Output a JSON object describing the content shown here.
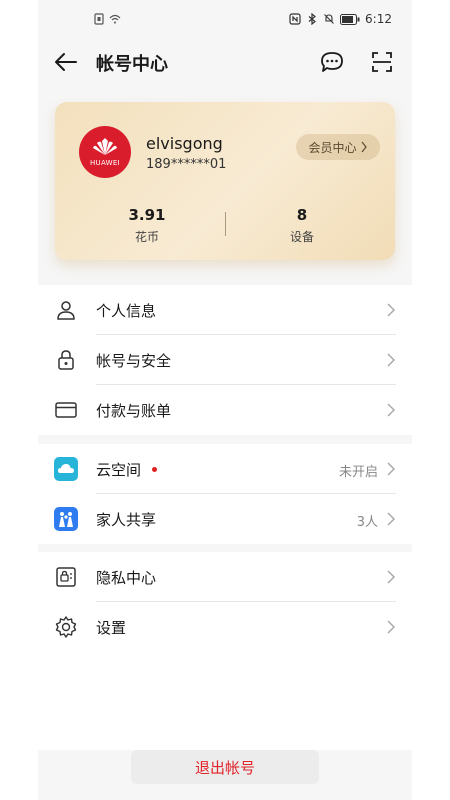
{
  "status_bar": {
    "time": "6:12"
  },
  "header": {
    "title": "帐号中心"
  },
  "account_card": {
    "username": "elvisgong",
    "phone": "189******01",
    "logo_text": "HUAWEI",
    "member_center_label": "会员中心",
    "stats": [
      {
        "value": "3.91",
        "label": "花币"
      },
      {
        "value": "8",
        "label": "设备"
      }
    ]
  },
  "menu_primary": [
    {
      "label": "个人信息",
      "icon": "person-icon"
    },
    {
      "label": "帐号与安全",
      "icon": "lock-icon"
    },
    {
      "label": "付款与账单",
      "icon": "card-icon"
    }
  ],
  "menu_services": [
    {
      "label": "云空间",
      "value": "未开启",
      "icon": "cloud-icon",
      "badge_color": "#e02020"
    },
    {
      "label": "家人共享",
      "value": "3人",
      "icon": "family-icon"
    }
  ],
  "menu_other": [
    {
      "label": "隐私中心",
      "icon": "privacy-icon"
    },
    {
      "label": "设置",
      "icon": "gear-icon"
    }
  ],
  "logout_label": "退出帐号",
  "colors": {
    "brand_red": "#d91d2c",
    "logout_text": "#e0242a"
  }
}
